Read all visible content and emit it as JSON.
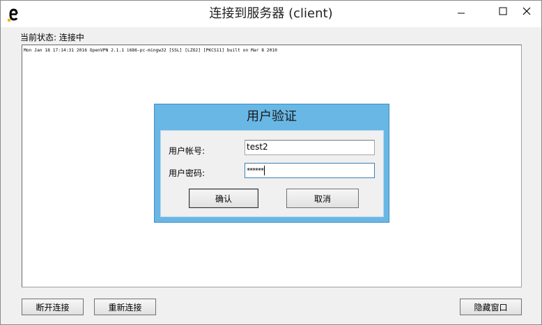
{
  "window": {
    "title": "连接到服务器 (client)",
    "icon": "e-app-icon",
    "controls": [
      "minimize-icon",
      "maximize-icon",
      "close-icon"
    ]
  },
  "status": {
    "text": "当前状态: 连接中"
  },
  "log": {
    "lines": [
      "Mon Jan 18 17:14:31 2016 OpenVPN 2.1.1 i686-pc-mingw32 [SSL] [LZO2] [PKCS11] built on Mar  8 2010"
    ]
  },
  "auth_dialog": {
    "title": "用户验证",
    "username_label": "用户帐号:",
    "username_value": "test2",
    "password_label": "用户密码:",
    "password_value": "******",
    "ok_label": "确认",
    "cancel_label": "取消"
  },
  "bottom_buttons": {
    "disconnect_label": "断开连接",
    "reconnect_label": "重新连接",
    "hide_label": "隐藏窗口"
  }
}
